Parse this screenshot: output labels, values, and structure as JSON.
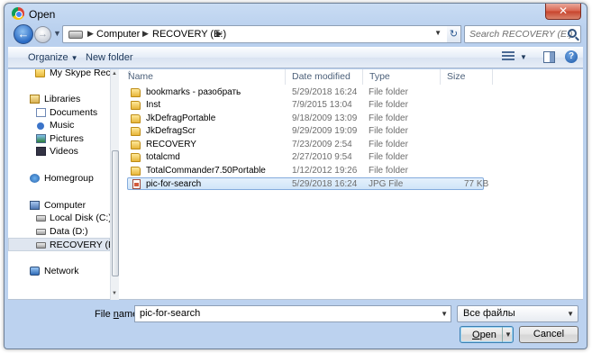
{
  "window": {
    "title": "Open",
    "close_label": "✕"
  },
  "address": {
    "crumbs": [
      "Computer",
      "RECOVERY (E:)"
    ],
    "search_placeholder": "Search RECOVERY (E:)"
  },
  "toolbar": {
    "organize_label": "Organize",
    "new_folder_label": "New folder",
    "help_label": "?"
  },
  "nav": {
    "items": [
      {
        "label": "My Skype Receiv",
        "icon": "folder-icon"
      },
      {
        "label": "Libraries",
        "icon": "libraries-icon"
      },
      {
        "label": "Documents",
        "icon": "documents-icon"
      },
      {
        "label": "Music",
        "icon": "music-icon"
      },
      {
        "label": "Pictures",
        "icon": "pictures-icon"
      },
      {
        "label": "Videos",
        "icon": "videos-icon"
      },
      {
        "label": "Homegroup",
        "icon": "homegroup-icon"
      },
      {
        "label": "Computer",
        "icon": "computer-icon"
      },
      {
        "label": "Local Disk (C:)",
        "icon": "disk-icon"
      },
      {
        "label": "Data (D:)",
        "icon": "disk-icon"
      },
      {
        "label": "RECOVERY (E:)",
        "icon": "disk-icon"
      },
      {
        "label": "Network",
        "icon": "network-icon"
      }
    ]
  },
  "columns": {
    "name": "Name",
    "date": "Date modified",
    "type": "Type",
    "size": "Size"
  },
  "files": [
    {
      "name": "bookmarks - разобрать",
      "date": "5/29/2018 16:24",
      "type": "File folder",
      "size": ""
    },
    {
      "name": "Inst",
      "date": "7/9/2015 13:04",
      "type": "File folder",
      "size": ""
    },
    {
      "name": "JkDefragPortable",
      "date": "9/18/2009 13:09",
      "type": "File folder",
      "size": ""
    },
    {
      "name": "JkDefragScr",
      "date": "9/29/2009 19:09",
      "type": "File folder",
      "size": ""
    },
    {
      "name": "RECOVERY",
      "date": "7/23/2009 2:54",
      "type": "File folder",
      "size": ""
    },
    {
      "name": "totalcmd",
      "date": "2/27/2010 9:54",
      "type": "File folder",
      "size": ""
    },
    {
      "name": "TotalCommander7.50Portable",
      "date": "1/12/2012 19:26",
      "type": "File folder",
      "size": ""
    },
    {
      "name": "pic-for-search",
      "date": "5/29/2018 16:24",
      "type": "JPG File",
      "size": "77 KB"
    }
  ],
  "bottom": {
    "filename_label_pre": "File ",
    "filename_label_ul": "n",
    "filename_label_post": "ame:",
    "filename_value": "pic-for-search",
    "filetype_value": "Все файлы",
    "open_label_ul": "O",
    "open_label_rest": "pen",
    "cancel_label": "Cancel"
  }
}
